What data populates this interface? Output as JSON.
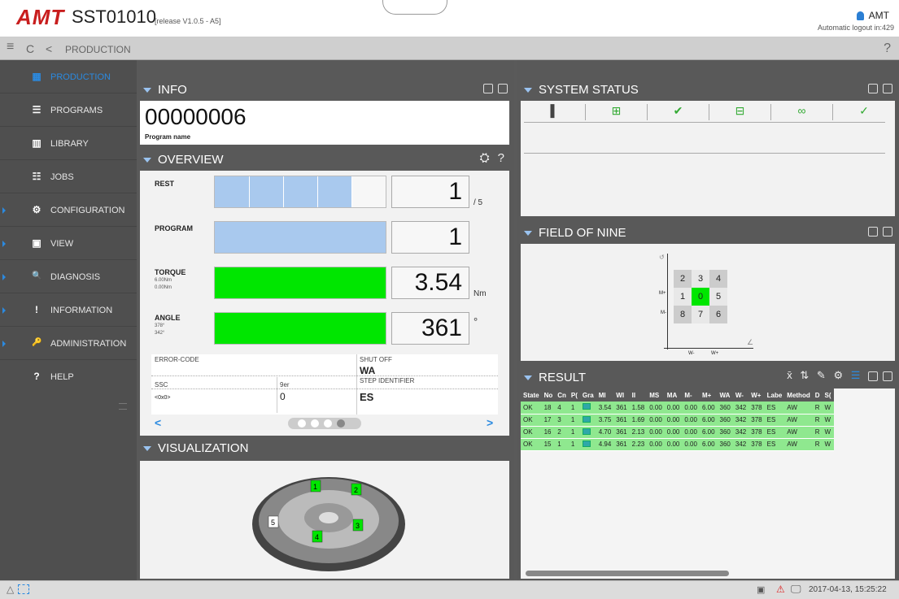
{
  "header": {
    "logo": "AMT",
    "title": "SST01010",
    "release": "[release V1.0.5 - A5]",
    "user": "AMT",
    "logout": "Automatic logout in:429"
  },
  "breadcrumb": {
    "menu_icon": "≡",
    "refresh_icon": "C",
    "back_icon": "<",
    "label": "PRODUCTION",
    "help": "?"
  },
  "sidebar": {
    "items": [
      {
        "label": "PRODUCTION",
        "icon": "▦"
      },
      {
        "label": "PROGRAMS",
        "icon": "☰"
      },
      {
        "label": "LIBRARY",
        "icon": "▥"
      },
      {
        "label": "JOBS",
        "icon": "☷"
      },
      {
        "label": "CONFIGURATION",
        "icon": "⚙"
      },
      {
        "label": "VIEW",
        "icon": "▣"
      },
      {
        "label": "DIAGNOSIS",
        "icon": "🔍"
      },
      {
        "label": "INFORMATION",
        "icon": "!"
      },
      {
        "label": "ADMINISTRATION",
        "icon": "🔑"
      },
      {
        "label": "HELP",
        "icon": "?"
      }
    ]
  },
  "info": {
    "title": "INFO",
    "program_number": "00000006",
    "program_label": "Program name"
  },
  "overview": {
    "title": "OVERVIEW",
    "help": "?",
    "rest": {
      "label": "REST",
      "value": "1",
      "suffix": "/ 5",
      "progress": 0.8
    },
    "program": {
      "label": "PROGRAM",
      "value": "1",
      "progress": 1.0
    },
    "torque": {
      "label": "TORQUE",
      "max": "6.00Nm",
      "min": "0.00Nm",
      "value": "3.54",
      "unit": "Nm",
      "progress": 1.0
    },
    "angle": {
      "label": "ANGLE",
      "max": "378°",
      "min": "342°",
      "value": "361",
      "unit": "°",
      "progress": 1.0
    },
    "error_code_label": "ERROR-CODE",
    "shut_off_label": "SHUT OFF",
    "shut_off_value": "WA",
    "ssc_label": "SSC",
    "ssc_value": "<0x0>",
    "9er_label": "9er",
    "9er_value": "0",
    "step_label": "STEP IDENTIFIER",
    "step_value": "ES"
  },
  "visualization": {
    "title": "VISUALIZATION",
    "markers": [
      "1",
      "2",
      "3",
      "4",
      "5"
    ]
  },
  "system_status": {
    "title": "SYSTEM STATUS"
  },
  "field_of_nine": {
    "title": "FIELD OF NINE",
    "cells": [
      [
        "2",
        "3",
        "4"
      ],
      [
        "1",
        "0",
        "5"
      ],
      [
        "8",
        "7",
        "6"
      ]
    ],
    "y_labels": [
      "M+",
      "M-"
    ],
    "x_labels": [
      "W-",
      "W+"
    ],
    "active": "0"
  },
  "result": {
    "title": "RESULT",
    "columns": [
      "State",
      "No",
      "Cn",
      "P(",
      "Gra",
      "MI",
      "WI",
      "II",
      "MS",
      "MA",
      "M-",
      "M+",
      "WA",
      "W-",
      "W+",
      "Labe",
      "Method",
      "D",
      "S("
    ],
    "rows": [
      [
        "OK",
        "18",
        "4",
        "1",
        "",
        "3.54",
        "361",
        "1.58",
        "0.00",
        "0.00",
        "0.00",
        "6.00",
        "360",
        "342",
        "378",
        "ES",
        "AW",
        "R",
        "W"
      ],
      [
        "OK",
        "17",
        "3",
        "1",
        "",
        "3.75",
        "361",
        "1.69",
        "0.00",
        "0.00",
        "0.00",
        "6.00",
        "360",
        "342",
        "378",
        "ES",
        "AW",
        "R",
        "W"
      ],
      [
        "OK",
        "16",
        "2",
        "1",
        "",
        "4.70",
        "361",
        "2.13",
        "0.00",
        "0.00",
        "0.00",
        "6.00",
        "360",
        "342",
        "378",
        "ES",
        "AW",
        "R",
        "W"
      ],
      [
        "OK",
        "15",
        "1",
        "1",
        "",
        "4.94",
        "361",
        "2.23",
        "0.00",
        "0.00",
        "0.00",
        "6.00",
        "360",
        "342",
        "378",
        "ES",
        "AW",
        "R",
        "W"
      ]
    ]
  },
  "statusbar": {
    "datetime": "2017-04-13, 15:25:22"
  },
  "colors": {
    "accent": "#2b8ae0",
    "ok_green": "#00e600",
    "bar_blue": "#a9c9ee",
    "row_green": "#8fe88f"
  }
}
